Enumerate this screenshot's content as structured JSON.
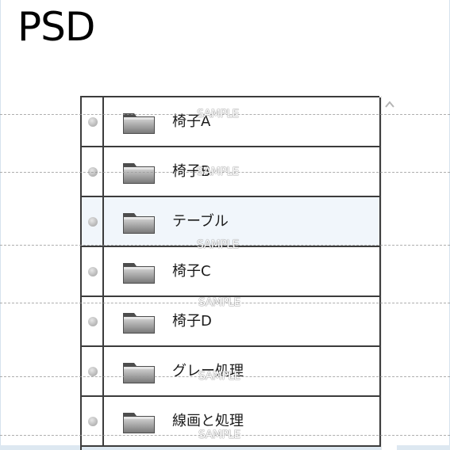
{
  "format_label": "PSD",
  "layers_panel": {
    "layers": [
      {
        "name": "椅子A",
        "selected": false
      },
      {
        "name": "椅子B",
        "selected": false
      },
      {
        "name": "テーブル",
        "selected": true
      },
      {
        "name": "椅子C",
        "selected": false
      },
      {
        "name": "椅子D",
        "selected": false
      },
      {
        "name": "グレー処理",
        "selected": false
      },
      {
        "name": "線画と処理",
        "selected": false
      }
    ],
    "icons": {
      "visibility": "visibility-dot-icon",
      "folder": "folder-icon",
      "scroll_up": "chevron-up-icon"
    }
  },
  "watermark": {
    "text": "SAMPLE"
  },
  "colors": {
    "border": "#3c3c3c",
    "selected_row": "#f1f6fb",
    "frame": "#d6e3ee"
  }
}
